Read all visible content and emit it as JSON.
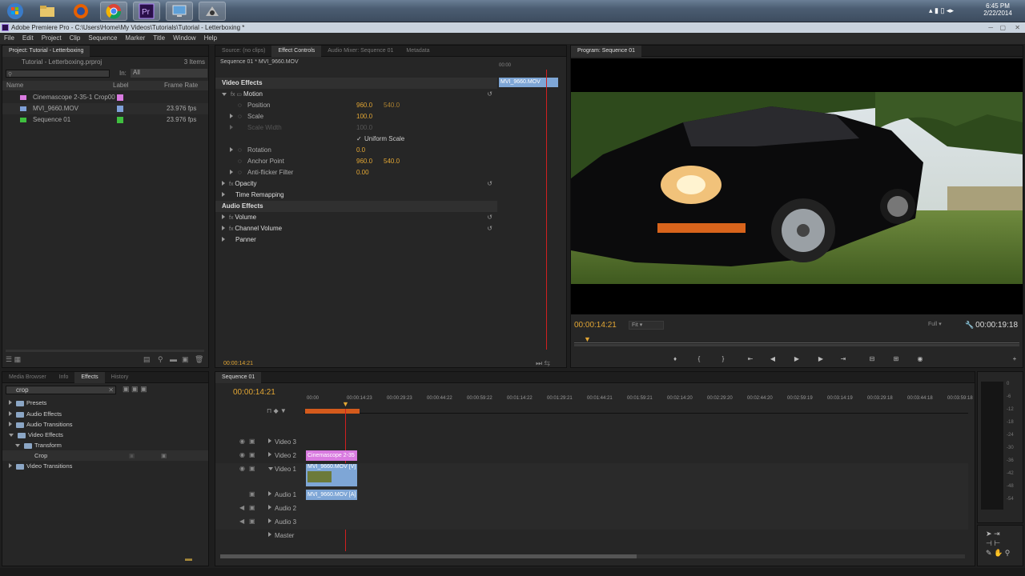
{
  "taskbar": {
    "time": "6:45 PM",
    "date": "2/22/2014",
    "apps": [
      "windows-start",
      "file-explorer",
      "firefox",
      "chrome",
      "premiere-pro",
      "remote-desktop",
      "media-app"
    ]
  },
  "window": {
    "title": "Adobe Premiere Pro - C:\\Users\\Home\\My Videos\\Tutorials\\Tutorial - Letterboxing *"
  },
  "menu": [
    "File",
    "Edit",
    "Project",
    "Clip",
    "Sequence",
    "Marker",
    "Title",
    "Window",
    "Help"
  ],
  "project": {
    "tab": "Project: Tutorial - Letterboxing",
    "file": "Tutorial - Letterboxing.prproj",
    "count": "3 Items",
    "in_label": "In:",
    "in_value": "All",
    "col_name": "Name",
    "col_label": "Label",
    "col_rate": "Frame Rate",
    "items": [
      {
        "name": "Cinemascope 2-35-1 Crop00",
        "rate": "",
        "color": "#d97be0"
      },
      {
        "name": "MVI_9660.MOV",
        "rate": "23.976 fps",
        "color": "#7fa0d8"
      },
      {
        "name": "Sequence 01",
        "rate": "23.976 fps",
        "color": "#3fbf3f"
      }
    ]
  },
  "effect_controls": {
    "tabs": [
      "Source: (no clips)",
      "Effect Controls",
      "Audio Mixer: Sequence 01",
      "Metadata"
    ],
    "clip": "Sequence 01 * MVI_9660.MOV",
    "clip_bar": "MVI_9660.MOV",
    "mini_time": "00:00",
    "video_effects": "Video Effects",
    "motion": "Motion",
    "position": "Position",
    "pos_x": "960.0",
    "pos_y": "540.0",
    "scale": "Scale",
    "scale_val": "100.0",
    "scale_width": "Scale Width",
    "scale_width_val": "100.0",
    "uniform": "Uniform Scale",
    "rotation": "Rotation",
    "rotation_val": "0.0",
    "anchor": "Anchor Point",
    "anchor_x": "960.0",
    "anchor_y": "540.0",
    "antiflicker": "Anti-flicker Filter",
    "antiflicker_val": "0.00",
    "opacity": "Opacity",
    "time_remap": "Time Remapping",
    "audio_effects": "Audio Effects",
    "volume": "Volume",
    "channel_volume": "Channel Volume",
    "panner": "Panner",
    "timecode": "00:00:14:21"
  },
  "program": {
    "tab": "Program: Sequence 01",
    "time": "00:00:14:21",
    "fit": "Fit",
    "full": "Full",
    "duration": "00:00:19:18"
  },
  "effects": {
    "tabs": [
      "Media Browser",
      "Info",
      "Effects",
      "History"
    ],
    "search": "crop",
    "tree": [
      "Presets",
      "Audio Effects",
      "Audio Transitions",
      "Video Effects",
      "Transform",
      "Crop",
      "Video Transitions"
    ]
  },
  "timeline": {
    "tab": "Sequence 01",
    "timecode": "00:00:14:21",
    "ruler": [
      "00:00",
      "00:00:14:23",
      "00:00:29:23",
      "00:00:44:22",
      "00:00:59:22",
      "00:01:14:22",
      "00:01:29:21",
      "00:01:44:21",
      "00:01:59:21",
      "00:02:14:20",
      "00:02:29:20",
      "00:02:44:20",
      "00:02:59:19",
      "00:03:14:19",
      "00:03:29:18",
      "00:03:44:18",
      "00:03:59:18"
    ],
    "tracks": [
      "Video 3",
      "Video 2",
      "Video 1",
      "Audio 1",
      "Audio 2",
      "Audio 3",
      "Master"
    ],
    "clip_v2": "Cinemascope 2-35",
    "clip_v1": "MVI_9660.MOV [V]",
    "clip_a1": "MVI_9660.MOV [A]"
  },
  "meter": {
    "ticks": [
      "0",
      "-6",
      "-12",
      "-18",
      "-24",
      "-30",
      "-36",
      "-42",
      "-48",
      "-54"
    ]
  }
}
